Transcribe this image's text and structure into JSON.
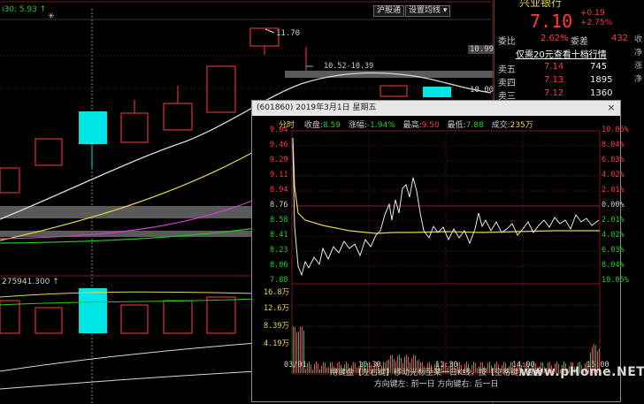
{
  "top_left": {
    "label": "i30: 5.93",
    "arrow": "↑"
  },
  "toolbar": {
    "shgt": "沪股通",
    "settings": "设置均线",
    "settings_arrow": "▾"
  },
  "main_chart": {
    "price_ticks": [
      "11.70",
      "10.99",
      "10.00"
    ],
    "range_label": "10.52-10.39",
    "volume_label": "275941.300",
    "volume_arrow": "↑"
  },
  "quote": {
    "stock_name": "兴业银行",
    "price": "7.10",
    "change": "+0.19",
    "change_pct": "+2.75%",
    "wei_bi_label": "委比",
    "wei_bi_value": "2.62%",
    "wei_cha_label": "委差",
    "wei_cha_value": "432",
    "banner": "仅需20元查看十档行情",
    "asks": [
      {
        "label": "卖五",
        "price": "7.14",
        "vol": "745"
      },
      {
        "label": "卖四",
        "price": "7.13",
        "vol": "1895"
      },
      {
        "label": "卖三",
        "price": "7.12",
        "vol": "1360"
      }
    ],
    "side_chars": [
      "收",
      "净",
      "涨",
      "净"
    ]
  },
  "popup": {
    "title": "(601860) 2019年3月1日 星期五",
    "close": "×",
    "info": {
      "fenshi": "分时",
      "shoupan_label": "收盘:",
      "shoupan": "8.59",
      "zhangfu_label": "涨幅:",
      "zhangfu": "-1.94%",
      "zuigao_label": "最高:",
      "zuigao": "9.50",
      "zuidi_label": "最低:",
      "zuidi": "7.88",
      "chengjiao_label": "成交:",
      "chengjiao": "235万"
    },
    "price_labels": [
      "9.64",
      "9.46",
      "9.29",
      "9.11",
      "8.94",
      "8.76",
      "8.58",
      "8.41",
      "8.23",
      "8.06",
      "7.88"
    ],
    "pct_labels": [
      "10.05%",
      "8.04%",
      "6.03%",
      "4.02%",
      "2.01%",
      "0.00%",
      "2.01%",
      "4.02%",
      "6.03%",
      "8.04%",
      "10.05%"
    ],
    "vol_labels": [
      "16.8万",
      "12.6万",
      "8.39万",
      "4.19万"
    ],
    "time_labels": [
      "03/01",
      "10:30",
      "11:30",
      "14:00",
      "15:00"
    ],
    "foot_line1": "用键盘【左右键】移动光标至某一日K线，按【空格键】查看",
    "foot_line2": "方向键左: 前一日   方向键右: 后一日"
  },
  "watermark": "www.pHome.NET",
  "colors": {
    "up": "#ff3b3b",
    "down": "#00e6e6",
    "green": "#22cc22",
    "yellow": "#e8d44a",
    "magenta": "#d040d0"
  }
}
